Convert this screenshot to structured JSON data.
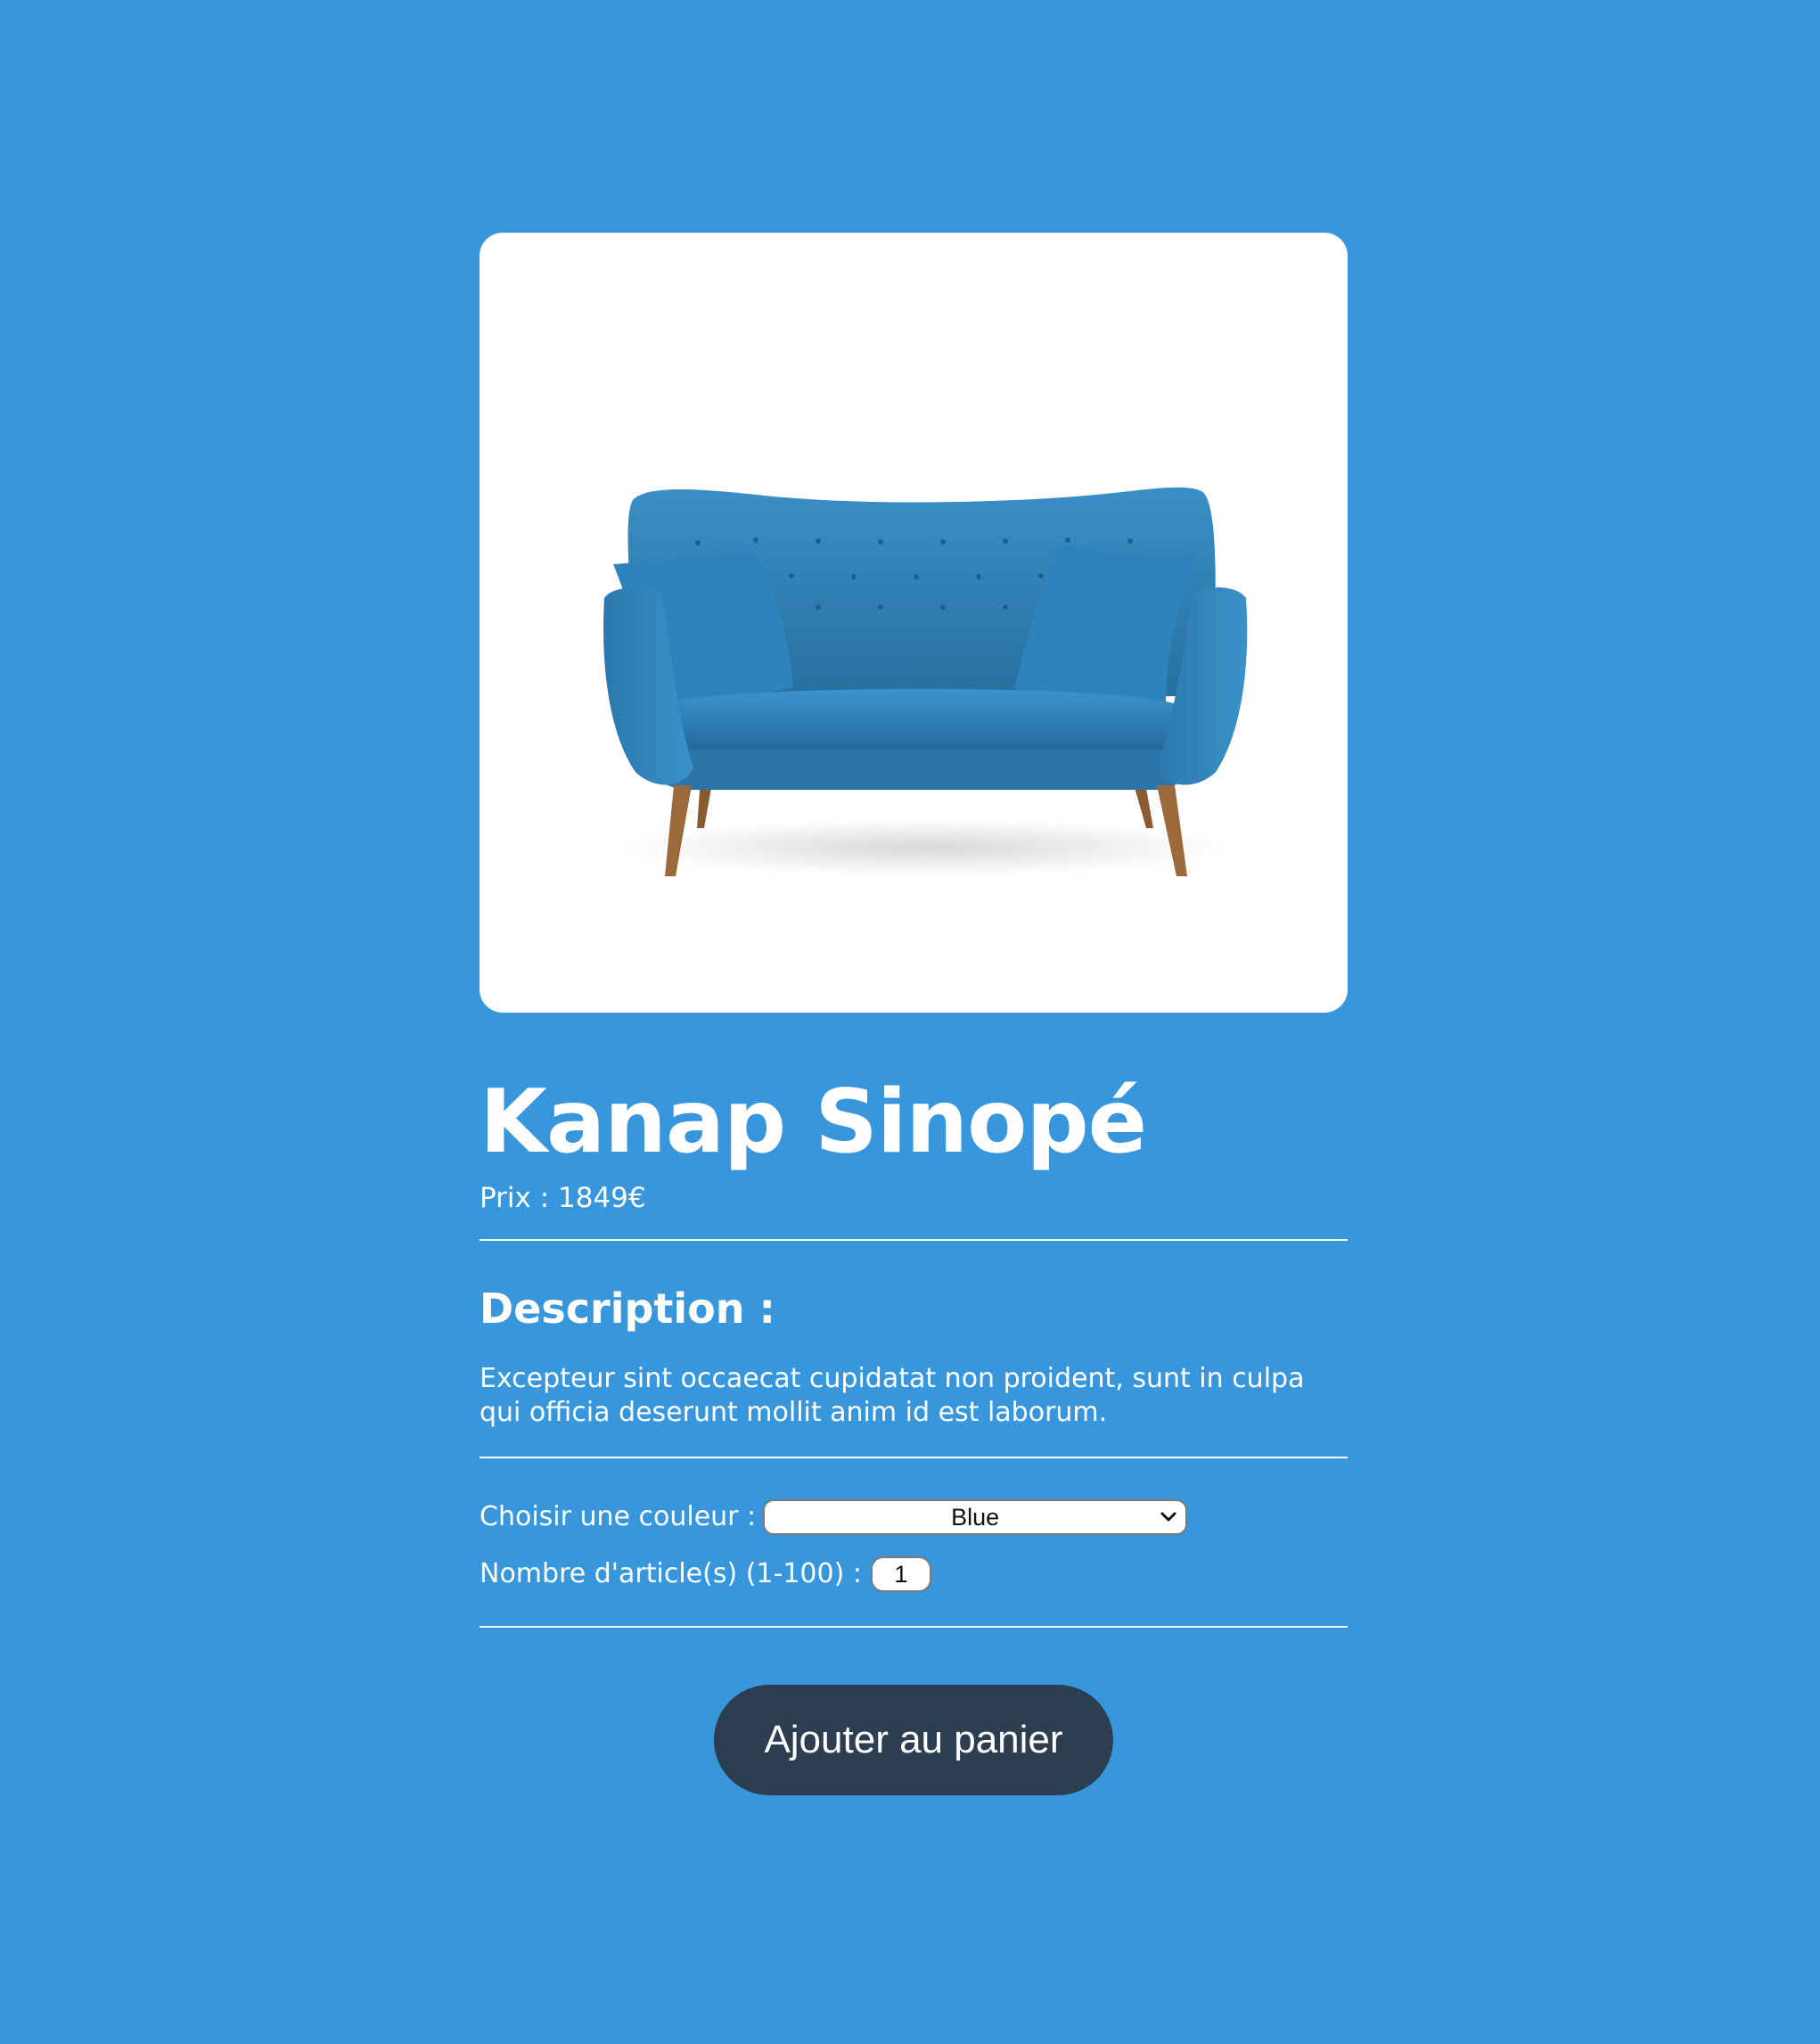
{
  "product": {
    "image_alt": "Blue two-seat sofa",
    "title": "Kanap Sinopé",
    "price_label": "Prix : ",
    "price_value": "1849",
    "currency": "€"
  },
  "description": {
    "heading": "Description :",
    "text": "Excepteur sint occaecat cupidatat non proident, sunt in culpa qui officia deserunt mollit anim id est laborum."
  },
  "options": {
    "color_label": "Choisir une couleur :",
    "color_selected": "Blue",
    "quantity_label": "Nombre d'article(s) (1-100) :",
    "quantity_value": "1"
  },
  "cart": {
    "add_button_label": "Ajouter au panier"
  },
  "colors": {
    "background": "#3897dc",
    "card": "#ffffff",
    "button": "#2c3e50",
    "sofa": "#2f7fb5"
  }
}
